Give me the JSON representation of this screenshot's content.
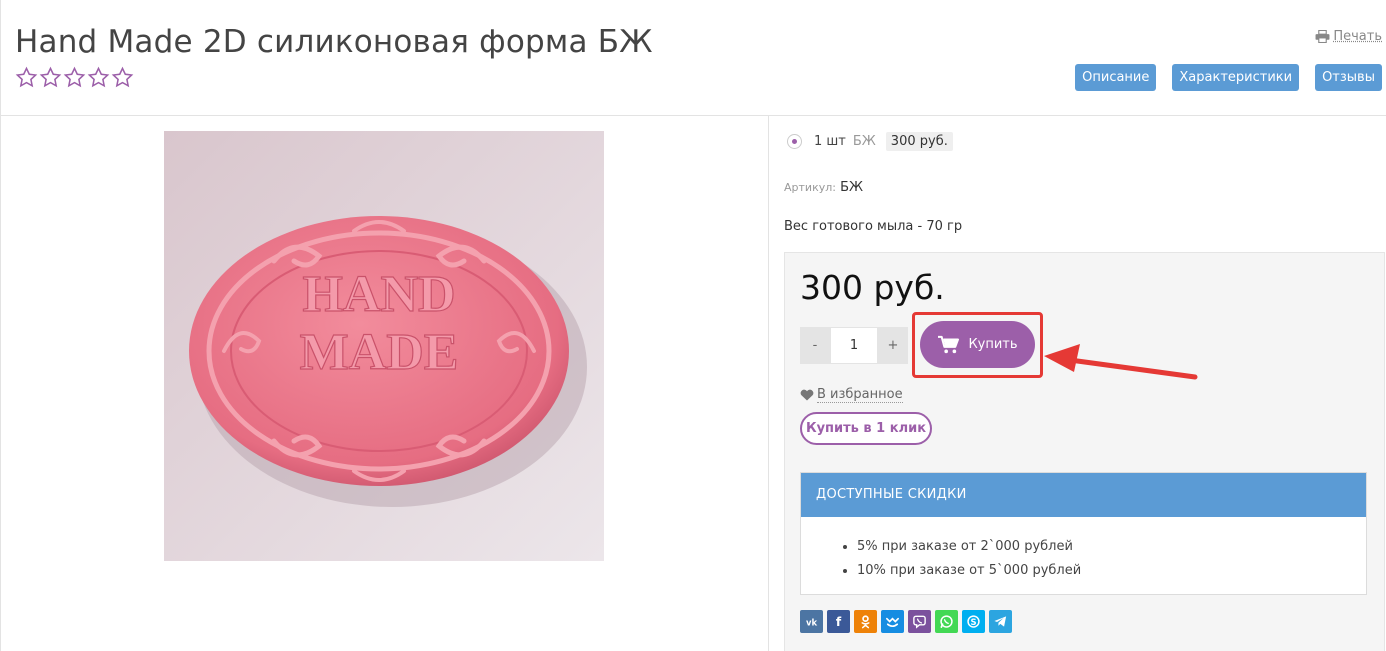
{
  "product": {
    "title": "Hand Made 2D силиконовая форма БЖ",
    "rating": 0,
    "rating_max": 5
  },
  "header": {
    "print_label": "Печать",
    "tabs": [
      {
        "label": "Описание"
      },
      {
        "label": "Характеристики"
      },
      {
        "label": "Отзывы"
      }
    ]
  },
  "image": {
    "line1": "HAND",
    "line2": "MADE"
  },
  "variant": {
    "quantity": "1 шт",
    "unit": "БЖ",
    "price": "300 руб."
  },
  "sku": {
    "label": "Артикул:",
    "value": "БЖ"
  },
  "weight_text": "Вес готового мыла - 70 гр",
  "buy": {
    "price": "300 руб.",
    "minus": "-",
    "plus": "+",
    "qty": "1",
    "buy_label": "Купить",
    "favorite_label": "В избранное",
    "one_click_label": "Купить в 1 клик"
  },
  "discounts": {
    "title": "ДОСТУПНЫЕ СКИДКИ",
    "items": [
      "5% при заказе от 2`000 рублей",
      "10% при заказе от 5`000 рублей"
    ]
  },
  "social": {
    "icons": [
      "vk-icon",
      "facebook-icon",
      "odnoklassniki-icon",
      "moimir-icon",
      "viber-icon",
      "whatsapp-icon",
      "skype-icon",
      "telegram-icon"
    ],
    "colors": {
      "vk": "#4c75a3",
      "facebook": "#3b5998",
      "odnoklassniki": "#ee8208",
      "moimir": "#168de2",
      "viber": "#7b519d",
      "whatsapp": "#43d854",
      "skype": "#00aff0",
      "telegram": "#2ca5e0"
    }
  },
  "colors": {
    "accent_purple": "#9c5fa9",
    "tab_blue": "#5b9bd5",
    "highlight_red": "#e53935"
  }
}
